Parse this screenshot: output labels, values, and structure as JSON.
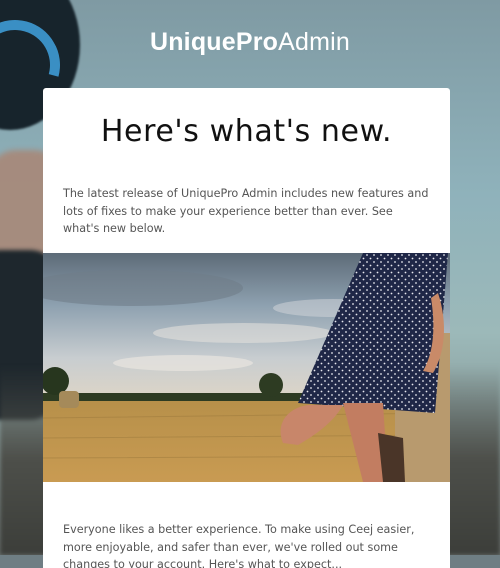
{
  "brand": {
    "bold": "UniquePro",
    "light": "Admin"
  },
  "card": {
    "title": "Here's what's new.",
    "intro": "The latest release of UniquePro Admin includes new features and lots of fixes to make your experience better than ever. See what's new below.",
    "body": "Everyone likes a better experience. To make using Ceej easier, more enjoyable, and safer than ever, we've rolled out some changes to your account. Here's what to expect..."
  }
}
